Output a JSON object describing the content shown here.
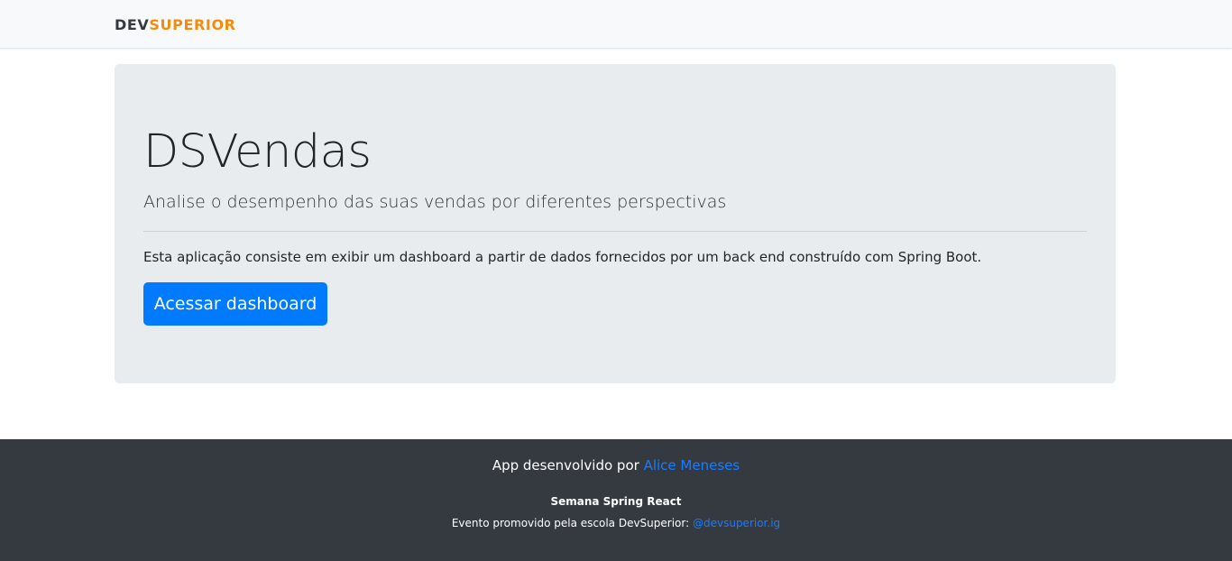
{
  "navbar": {
    "logo_part1": "DEV",
    "logo_part2": "SUPERIOR",
    "logo_color_dark": "#343a40",
    "logo_color_accent": "#f28c0e"
  },
  "hero": {
    "title": "DSVendas",
    "lead": "Analise o desempenho das suas vendas por diferentes perspectivas",
    "description": "Esta aplicação consiste em exibir um dashboard a partir de dados fornecidos por um back end construído com Spring Boot.",
    "button_label": "Acessar dashboard",
    "button_color": "#007bff"
  },
  "footer": {
    "credit_prefix": "App desenvolvido por",
    "credit_name": "Alice Meneses",
    "event_title": "Semana Spring React",
    "event_prefix": "Evento promovido pela escola DevSuperior:",
    "event_link": "@devsuperior.ig",
    "background": "#343a40",
    "link_color": "#1a7bff"
  }
}
